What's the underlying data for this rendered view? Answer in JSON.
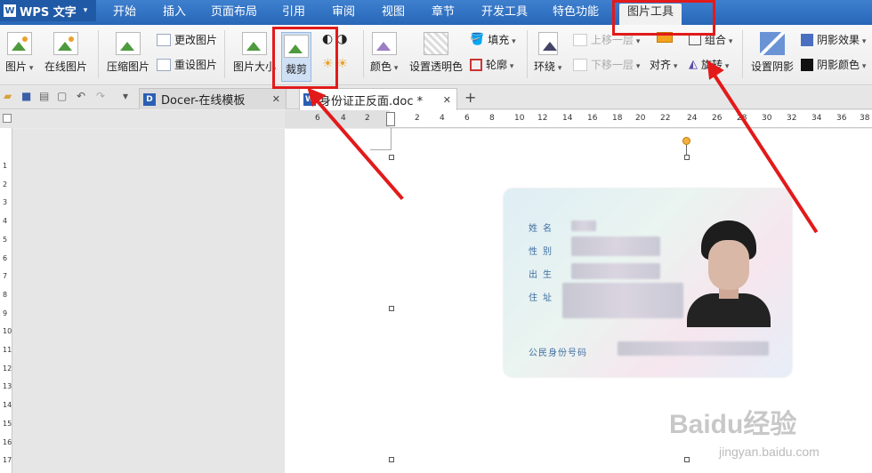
{
  "app": {
    "title": "WPS 文字"
  },
  "menu": [
    "开始",
    "插入",
    "页面布局",
    "引用",
    "审阅",
    "视图",
    "章节",
    "开发工具",
    "特色功能",
    "图片工具"
  ],
  "ribbon": {
    "picture": "图片",
    "online_picture": "在线图片",
    "compress": "压缩图片",
    "change_picture": "更改图片",
    "reset_picture": "重设图片",
    "picture_size": "图片大小",
    "crop": "裁剪",
    "color": "颜色",
    "transparent": "设置透明色",
    "fill": "填充",
    "outline": "轮廓",
    "wrap": "环绕",
    "bring_forward": "上移一层",
    "send_backward": "下移一层",
    "align": "对齐",
    "group": "组合",
    "rotate": "旋转",
    "set_shadow": "设置阴影",
    "shadow_effect": "阴影效果",
    "shadow_color": "阴影颜色"
  },
  "tabs": {
    "docer": "Docer-在线模板",
    "document": "身份证正反面.doc *",
    "add": "+"
  },
  "ruler": {
    "h_ticks": [
      "6",
      "4",
      "2",
      "2",
      "4",
      "6",
      "8",
      "10",
      "12",
      "14",
      "16",
      "18",
      "20",
      "22",
      "24",
      "26",
      "28",
      "30",
      "32",
      "34",
      "36",
      "38"
    ],
    "v_ticks": [
      "1",
      "2",
      "3",
      "4",
      "5",
      "6",
      "7",
      "8",
      "9",
      "10",
      "11",
      "12",
      "13",
      "14",
      "15",
      "16",
      "17"
    ]
  },
  "idcard": {
    "name_label": "姓名",
    "gender_label": "性别",
    "birth_label": "出生",
    "address_label": "住址",
    "id_label": "公民身份号码"
  },
  "watermark": {
    "logo": "Baidu经验",
    "url": "jingyan.baidu.com"
  },
  "colors": {
    "menubar": "#2867b8",
    "annotation": "#e21a1a"
  }
}
